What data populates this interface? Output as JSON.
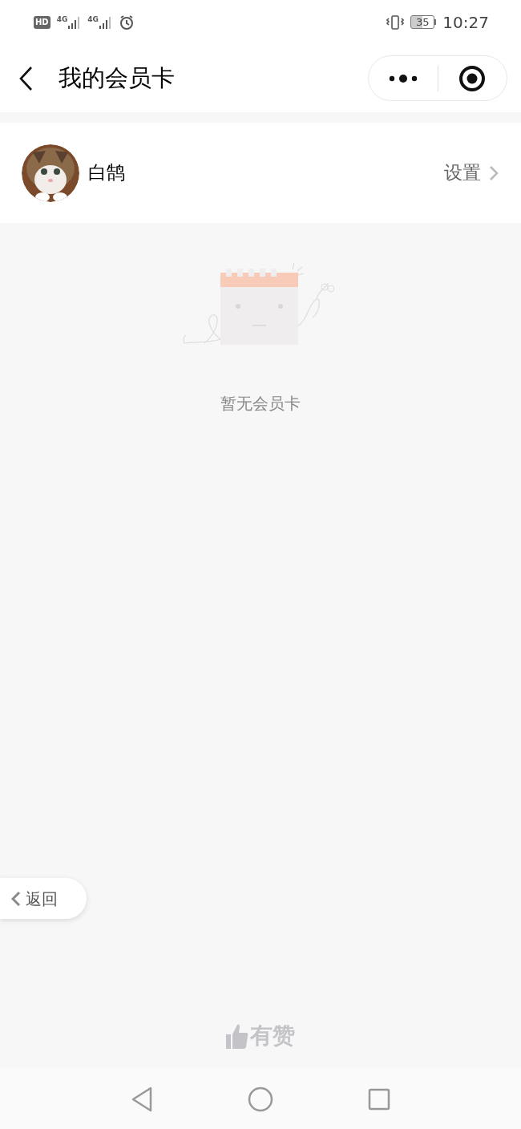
{
  "status_bar": {
    "hd": "HD",
    "sim_1": "4G",
    "sim_2": "4G",
    "battery": "35",
    "time": "10:27"
  },
  "header": {
    "title": "我的会员卡"
  },
  "profile": {
    "name": "白鹄",
    "settings": "设置"
  },
  "empty_state": {
    "message": "暂无会员卡"
  },
  "floating_back": {
    "label": "返回"
  },
  "footer": {
    "brand": "有赞"
  }
}
